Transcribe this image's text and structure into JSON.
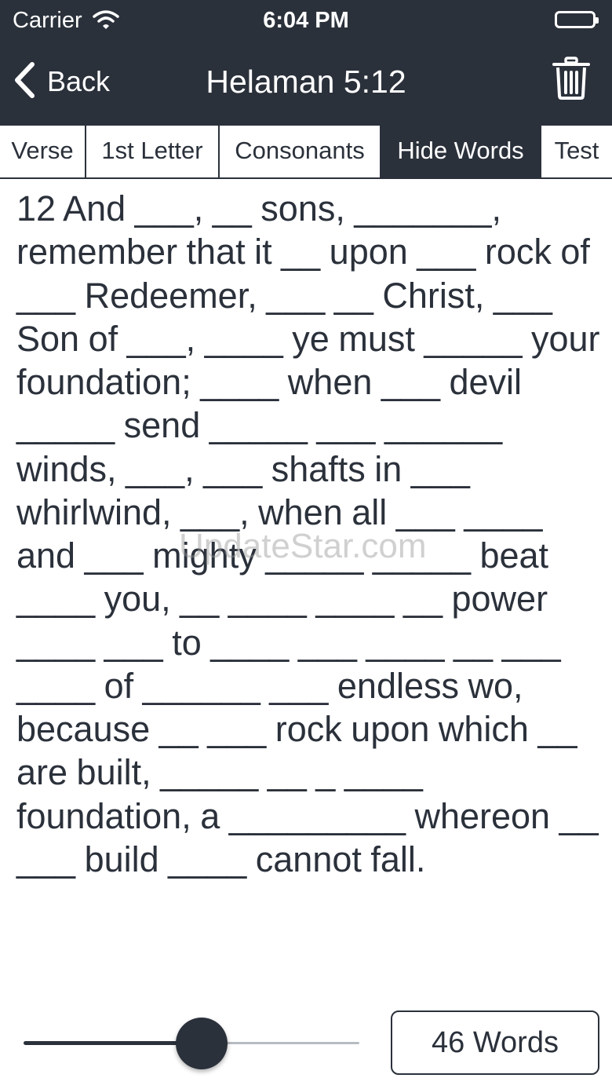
{
  "status_bar": {
    "carrier": "Carrier",
    "time": "6:04 PM",
    "wifi_icon": "wifi-icon",
    "battery_icon": "battery-icon"
  },
  "nav": {
    "back_label": "Back",
    "back_icon": "chevron-left-icon",
    "title": "Helaman 5:12",
    "trash_icon": "trash-icon"
  },
  "tabs": [
    {
      "label": "Verse",
      "active": false
    },
    {
      "label": "1st Letter",
      "active": false
    },
    {
      "label": "Consonants",
      "active": false
    },
    {
      "label": "Hide Words",
      "active": true
    },
    {
      "label": "Test",
      "active": false
    }
  ],
  "verse": {
    "text": "12 And ___, __ sons, _______, remember that it __ upon ___ rock of ___ Redeemer, ___ __ Christ, ___ Son of ___, ____ ye must _____ your foundation; ____ when ___ devil _____ send _____ ___ ______ winds, ___, ___ shafts in ___ whirlwind, ___, when all ___ ____ and ___ mighty _____ _____ beat ____ you, __ ____ ____ __ power ____ ___ to ____ ___ ____ __ ___ ____ of ______ ___ endless wo, because __ ___ rock upon which __ are built, _____ __ _ ____ foundation, a _________ whereon __ ___ build ____ cannot fall."
  },
  "watermark": "UpdateStar.com",
  "slider": {
    "fraction": 0.53
  },
  "word_count": {
    "label": "46 Words"
  },
  "colors": {
    "dark": "#2b313b",
    "background": "#ffffff",
    "track_max": "#b7bcc2"
  }
}
